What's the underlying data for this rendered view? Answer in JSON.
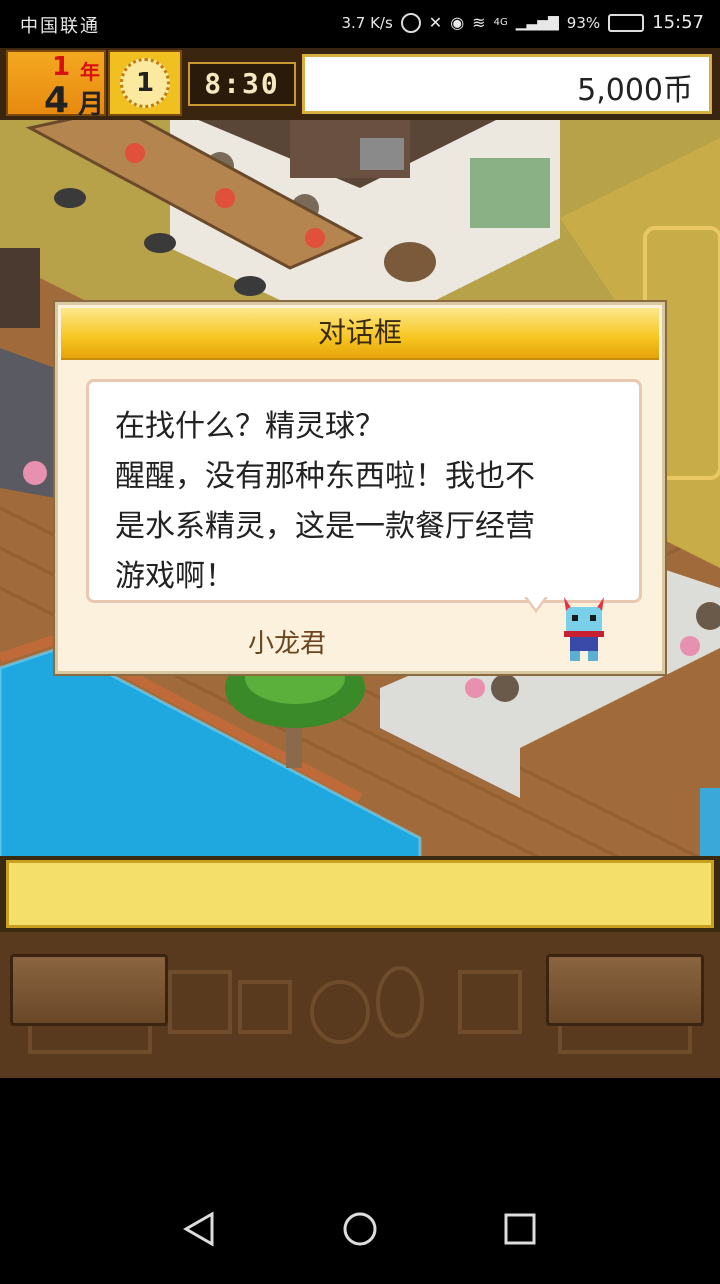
{
  "status_bar": {
    "carrier": "中国联通",
    "speed": "3.7 K/s",
    "network": "4G",
    "battery": "93%",
    "time": "15:57"
  },
  "hud": {
    "year": "1",
    "year_label": "年",
    "month": "4",
    "month_label": "月",
    "clock_hour": "1",
    "time": "8:30",
    "money": "5,000币"
  },
  "dialog": {
    "title": "对话框",
    "lines": [
      "在找什么？精灵球？",
      "醒醒，没有那种东西啦！我也不",
      "是水系精灵，这是一款餐厅经营",
      "游戏啊！"
    ],
    "speaker": "小龙君"
  },
  "icons": {
    "back": "back-triangle-icon",
    "home": "home-circle-icon",
    "recents": "recents-square-icon"
  },
  "colors": {
    "water": "#1fa8e0",
    "deck": "#a06a3a",
    "grass": "#b7a24a",
    "banner": "#f6c520"
  }
}
